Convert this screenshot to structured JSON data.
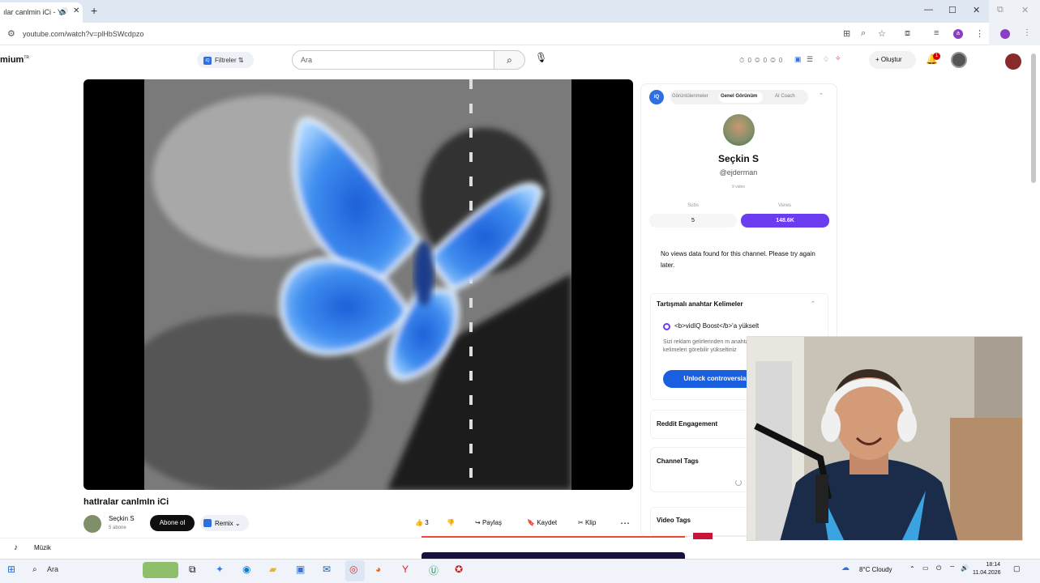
{
  "browser": {
    "tab_title": "ılar canlmin iCi - Yo",
    "address": "youtube.com/watch?v=plHbSWcdpzo",
    "profile_initial": "a"
  },
  "youtube": {
    "logo_text": "mium",
    "logo_sup": "TR",
    "filters_label": "Filtreler",
    "search_placeholder": "Ara",
    "header_stats": "⏱ 0 ◎ 0 ◎ 0",
    "create_label": "Oluştur",
    "notification_count": "1"
  },
  "video": {
    "title": "hatIralar canlmIn iCi",
    "channel_name": "Seçkin S",
    "channel_subs": "5 abone",
    "subscribe_label": "Abone ol",
    "remix_label": "Remix",
    "like_count": "3",
    "share_label": "Paylaş",
    "save_label": "Kaydet",
    "clip_label": "Klip"
  },
  "vidiq": {
    "logo": "iQ",
    "tabs": [
      "Görüntülenmeler",
      "Genel Görünüm",
      "AI Coach"
    ],
    "channel_name": "Seçkin S",
    "handle": "@ejderman",
    "videos_count": "9 video",
    "subs_label": "Subs",
    "views_label": "Views",
    "subs_value": "5",
    "views_value": "148.6K",
    "no_views_message": "No views data found for this channel. Please try again later.",
    "keywords_title": "Tartışmalı anahtar Kelimeler",
    "boost_text": "<b>vidIQ Boost</b>'a yükselt",
    "boost_desc": "Sizi reklam gelirlerinden m anahtar kelimeleri görebilir yükseltiniz",
    "unlock_label": "Unlock controversial",
    "reddit_title": "Reddit Engagement",
    "channel_tags_title": "Channel Tags",
    "video_tags_title": "Video Tags"
  },
  "bottom": {
    "music_label": "Müzik"
  },
  "taskbar": {
    "search_label": "Ara",
    "weather": "8°C Cloudy",
    "time": "18:14",
    "date": "11.04.2026"
  }
}
